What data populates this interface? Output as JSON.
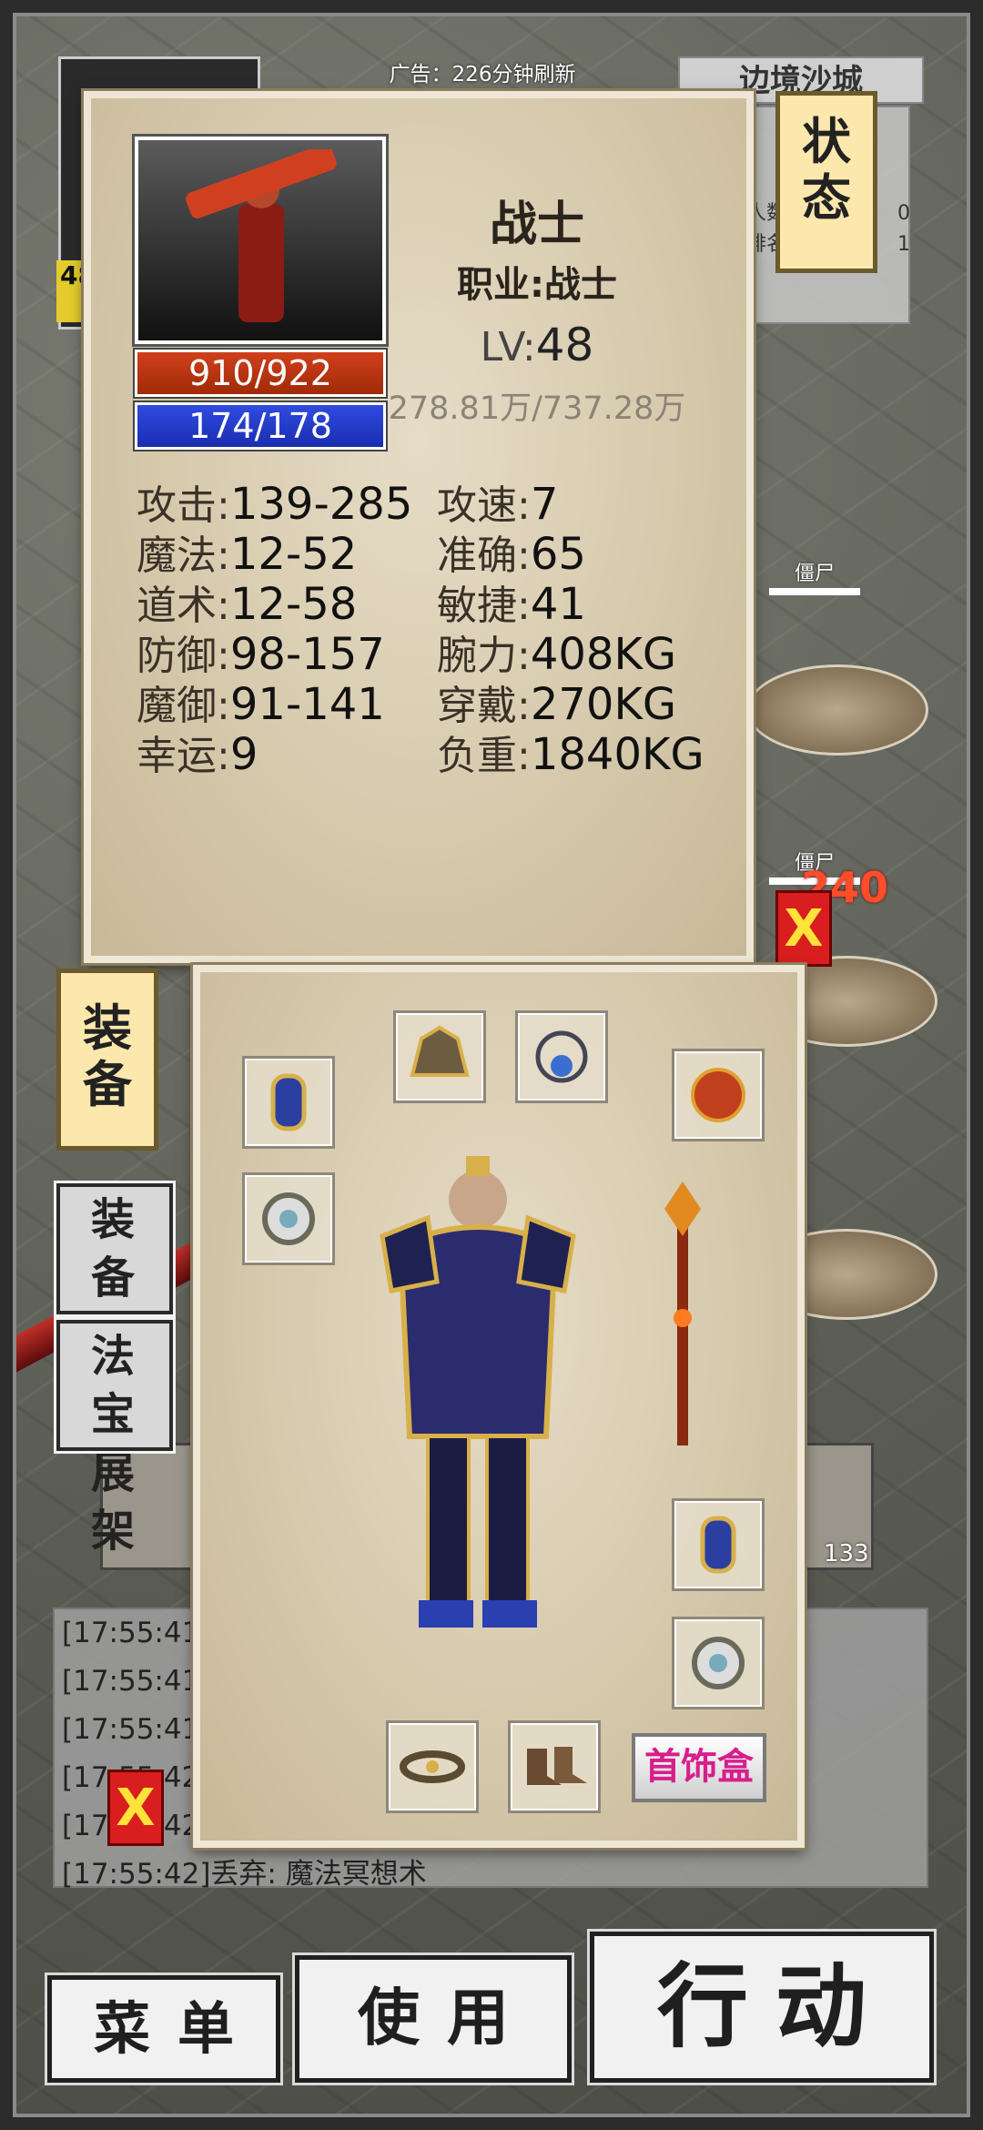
{
  "top_bar": {
    "ad_text": "广告：226分钟刷新",
    "player_level": "48"
  },
  "zone": {
    "name": "边境沙城",
    "rows": [
      {
        "label": "人数:",
        "value": "0"
      },
      {
        "label": "排名:",
        "value": "1"
      }
    ]
  },
  "mobs": [
    {
      "name": "僵尸"
    },
    {
      "name": "僵尸"
    }
  ],
  "damage_popup": "240",
  "inventory": {
    "item_count": "133"
  },
  "status": {
    "tab_label": "状态",
    "name": "战士",
    "job": "职业:战士",
    "lv_label": "LV:",
    "lv_value": "48",
    "exp": "278.81万/737.28万",
    "hp": "910/922",
    "mp": "174/178",
    "stats_left": [
      {
        "label": "攻击:",
        "value": "139-285"
      },
      {
        "label": "魔法:",
        "value": "12-52"
      },
      {
        "label": "道术:",
        "value": "12-58"
      },
      {
        "label": "防御:",
        "value": "98-157"
      },
      {
        "label": "魔御:",
        "value": "91-141"
      },
      {
        "label": "幸运:",
        "value": "9"
      }
    ],
    "stats_right": [
      {
        "label": "攻速:",
        "value": "7"
      },
      {
        "label": "准确:",
        "value": "65"
      },
      {
        "label": "敏捷:",
        "value": "41"
      },
      {
        "label": "腕力:",
        "value": "408KG"
      },
      {
        "label": "穿戴:",
        "value": "270KG"
      },
      {
        "label": "负重:",
        "value": "1840KG"
      }
    ]
  },
  "equipment": {
    "tab_label": "装备",
    "jewel_box_label": "首饰盒",
    "slots": [
      "helmet-icon",
      "necklace-icon",
      "bracelet-icon",
      "medal-icon",
      "ring-icon",
      "weapon-icon",
      "bracelet-icon",
      "ring-icon",
      "belt-icon",
      "boots-icon",
      "gem-icon"
    ]
  },
  "side_buttons": {
    "equip_shelf": "装备展架",
    "treasure_shelf": "法宝展架"
  },
  "log": [
    "[17:55:41",
    "[17:55:41",
    "[17:55:41",
    "[17:55:42",
    "[17:55:42",
    "[17:55:42]丢弃: 魔法冥想术"
  ],
  "bottom_bar": {
    "menu": "菜单",
    "use": "使用",
    "action": "行动"
  },
  "colors": {
    "hp_bar": "#b8351a",
    "mp_bar": "#2238c8",
    "close_button": "#d81e1e",
    "jewel_text": "#d81e8c",
    "tab_bg": "#fce8ad"
  }
}
